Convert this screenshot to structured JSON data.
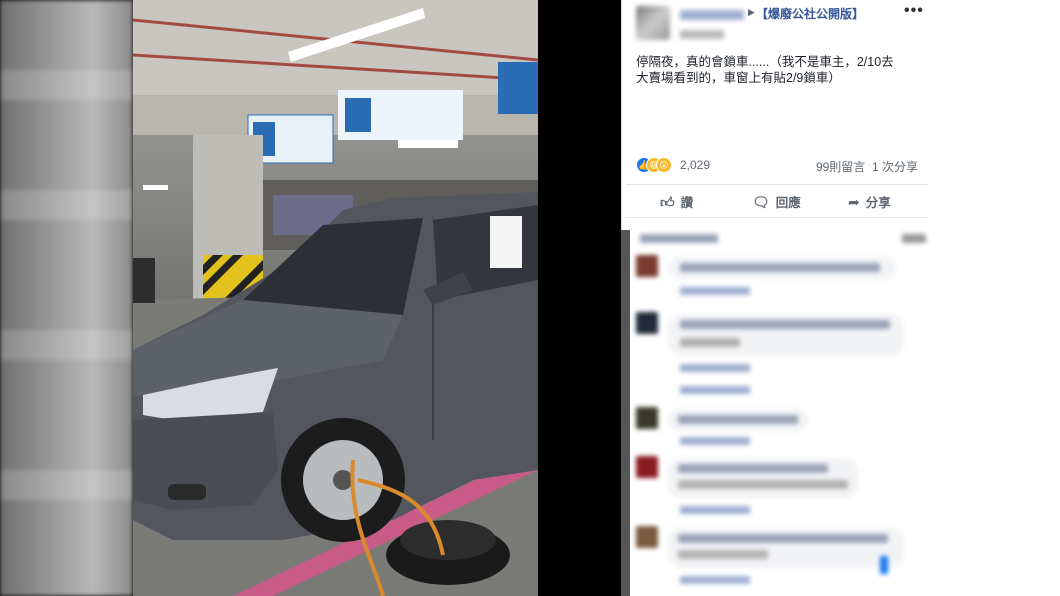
{
  "post": {
    "group_name": "【爆廢公社公開版】",
    "more_label": "•••",
    "text_line1": "停隔夜，真的會鎖車......（我不是車主，2/10去",
    "text_line2": "大賣場看到的，車窗上有貼2/9鎖車）",
    "reaction_count": "2,029",
    "comment_count": "99則留言",
    "share_count": "1 次分享"
  },
  "actions": {
    "like": "讚",
    "comment": "回應",
    "share": "分享"
  },
  "icons": {
    "like": "thumbs-up-icon",
    "comment": "comment-icon",
    "share": "share-arrow-icon"
  },
  "colors": {
    "link": "#365899",
    "like_blue": "#1877f2",
    "haha_yellow": "#f7b928"
  }
}
